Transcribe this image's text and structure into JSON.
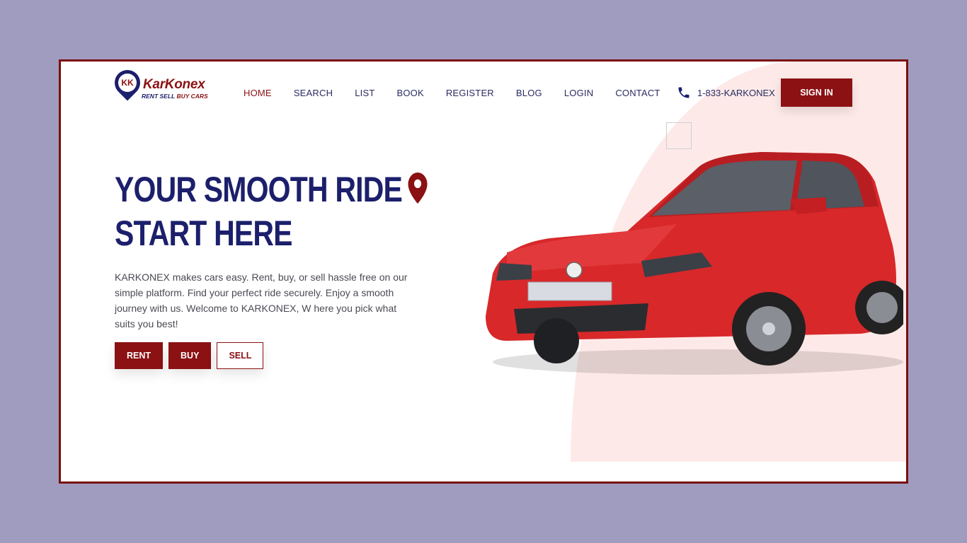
{
  "brand": {
    "logo_initials": "KK",
    "logo_name": "KarKonex",
    "tagline_part1": "RENT SELL ",
    "tagline_part2": "BUY CARS"
  },
  "nav": {
    "items": [
      "HOME",
      "SEARCH",
      "LIST",
      "BOOK",
      "REGISTER",
      "BLOG",
      "LOGIN",
      "CONTACT"
    ],
    "active": "HOME"
  },
  "header": {
    "phone_icon": "phone-icon",
    "phone": "1-833-KARKONEX",
    "signin_label": "SIGN IN"
  },
  "hero": {
    "title_line1": "YOUR SMOOTH RIDE",
    "title_line2": "START HERE",
    "title_icon": "location-pin-icon",
    "description": "KARKONEX makes cars easy. Rent, buy, or sell hassle free on our simple platform. Find your perfect ride securely. Enjoy a smooth journey with us. Welcome to KARKONEX, W here you pick what suits you best!",
    "buttons": {
      "rent": "RENT",
      "buy": "BUY",
      "sell": "SELL"
    },
    "image": "red-hatchback-car"
  },
  "colors": {
    "brand_red": "#8b1113",
    "navy": "#1c1f6b",
    "pink_bg": "#fdeae8",
    "page_bg": "#a09cbf"
  }
}
